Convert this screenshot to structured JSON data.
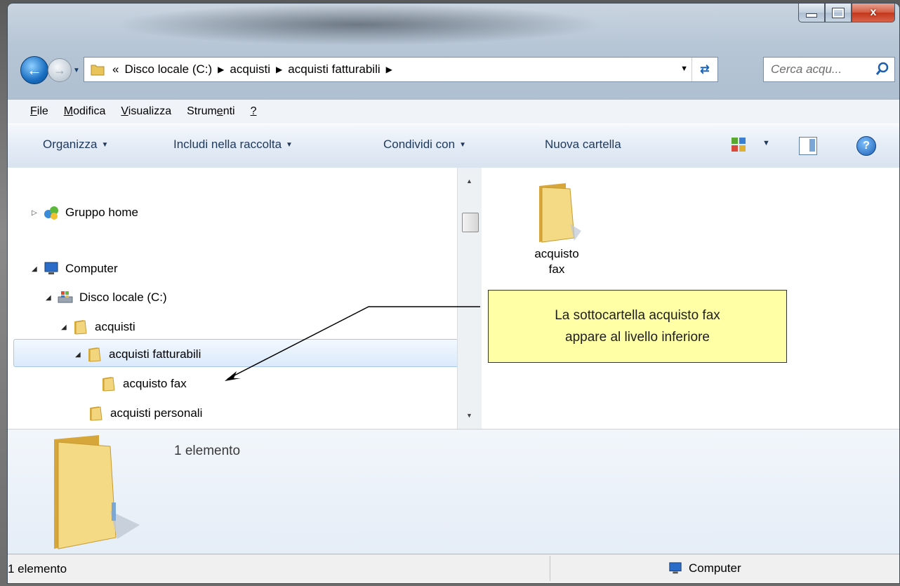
{
  "window": {
    "caption_close": "x"
  },
  "nav": {
    "overflow_chevron": "«",
    "address": [
      "Disco locale (C:)",
      "acquisti",
      "acquisti fatturabili"
    ],
    "search_placeholder": "Cerca acqu..."
  },
  "menu": {
    "file": {
      "u": "F",
      "rest": "ile"
    },
    "modifica": {
      "u": "M",
      "rest": "odifica"
    },
    "visualizza": {
      "u": "V",
      "rest": "isualizza"
    },
    "strumenti": {
      "a": "Strum",
      "u": "e",
      "b": "nti"
    },
    "help": "?"
  },
  "commands": {
    "organizza": "Organizza",
    "includi": "Includi nella raccolta",
    "condividi": "Condividi con",
    "nuova": "Nuova cartella"
  },
  "tree": {
    "gruppo_home": "Gruppo home",
    "computer": "Computer",
    "disco": "Disco locale (C:)",
    "acquisti": "acquisti",
    "acquisti_fatturabili": "acquisti fatturabili",
    "acquisto_fax": "acquisto fax",
    "acquisti_personali": "acquisti personali"
  },
  "content": {
    "item_line1": "acquisto",
    "item_line2": "fax"
  },
  "callout": {
    "line1": "La sottocartella acquisto fax",
    "line2": "appare al livello inferiore"
  },
  "details": {
    "count": "1 elemento"
  },
  "status": {
    "left": "1 elemento",
    "right": "Computer"
  },
  "colors": {
    "folder": "#e9c45a",
    "selection": "#dbeafc",
    "callout_bg": "#ffffa6",
    "close_button": "#c1371c"
  }
}
